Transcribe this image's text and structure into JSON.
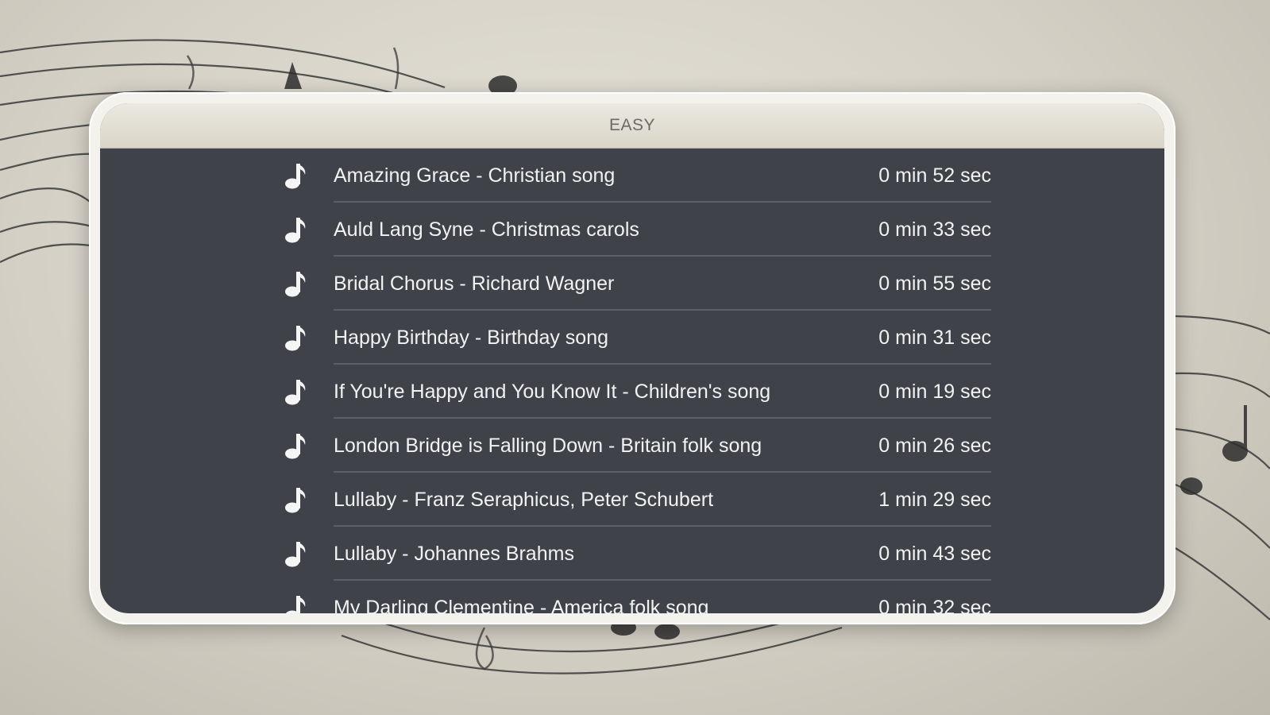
{
  "header": {
    "title": "EASY"
  },
  "songs": [
    {
      "title": "Amazing Grace - Christian song",
      "duration": "0 min 52 sec"
    },
    {
      "title": "Auld Lang Syne - Christmas carols",
      "duration": "0 min 33 sec"
    },
    {
      "title": "Bridal Chorus - Richard Wagner",
      "duration": "0 min 55 sec"
    },
    {
      "title": "Happy Birthday - Birthday song",
      "duration": "0 min 31 sec"
    },
    {
      "title": "If You're Happy and You Know It - Children's song",
      "duration": "0 min 19 sec"
    },
    {
      "title": "London Bridge is Falling Down - Britain folk song",
      "duration": "0 min 26 sec"
    },
    {
      "title": "Lullaby - Franz Seraphicus, Peter Schubert",
      "duration": "1 min 29 sec"
    },
    {
      "title": "Lullaby - Johannes Brahms",
      "duration": "0 min 43 sec"
    },
    {
      "title": "My Darling Clementine - America folk song",
      "duration": "0 min 32 sec"
    }
  ],
  "icons": {
    "row_icon": "music-note-icon",
    "background": "music-staff-decoration"
  },
  "colors": {
    "panel": "#3f4248",
    "header": "#e2dfd6",
    "text": "#f2f2f2",
    "background": "#d4d0c5"
  }
}
